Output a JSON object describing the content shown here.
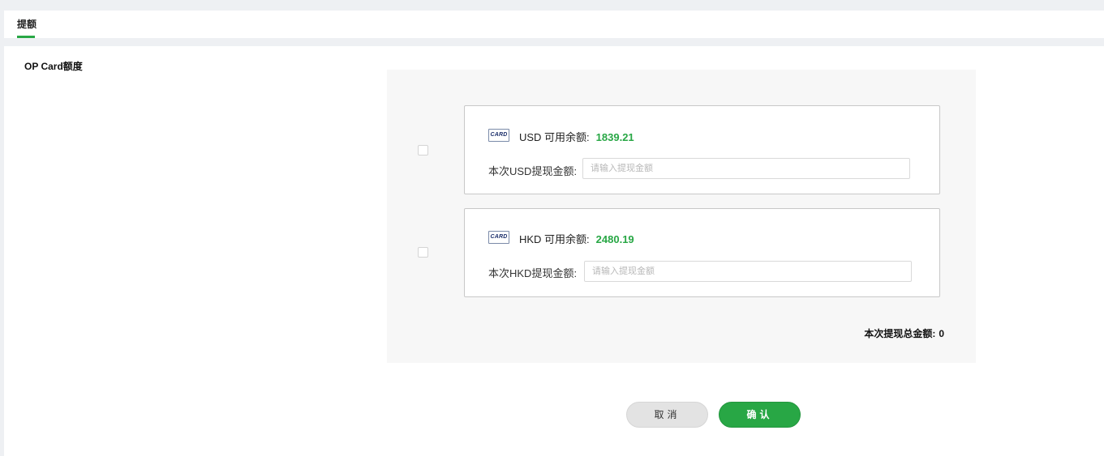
{
  "tabs": [
    {
      "label": "提额",
      "active": true
    }
  ],
  "section": {
    "title": "OP Card额度"
  },
  "cards": [
    {
      "logo_text": "CARD",
      "currency": "USD",
      "balance_label": "USD 可用余额:",
      "balance_value": "1839.21",
      "amount_label": "本次USD提现金额:",
      "amount_placeholder": "请输入提现金额",
      "amount_value": "",
      "checked": false
    },
    {
      "logo_text": "CARD",
      "currency": "HKD",
      "balance_label": "HKD 可用余额:",
      "balance_value": "2480.19",
      "amount_label": "本次HKD提现金额:",
      "amount_placeholder": "请输入提现金额",
      "amount_value": "",
      "checked": false
    }
  ],
  "total": {
    "label": "本次提现总金额:",
    "value": "0"
  },
  "actions": {
    "cancel_label": "取消",
    "confirm_label": "确认"
  },
  "colors": {
    "accent": "#28a745",
    "panel_bg": "#f7f7f7",
    "page_bg": "#eef0f3"
  }
}
